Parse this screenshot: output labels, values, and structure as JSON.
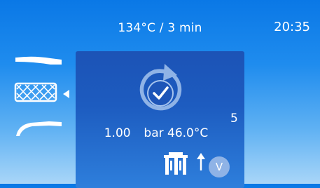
{
  "header": {
    "program": "134°C / 3 min",
    "time": "20:35"
  },
  "sidebar": {
    "items": [
      {
        "icon": "straight-handpiece-icon"
      },
      {
        "icon": "mesh-basket-icon",
        "selected": true
      },
      {
        "icon": "contra-angle-handpiece-icon"
      }
    ]
  },
  "status": {
    "icon": "cycle-complete-icon",
    "cycle_count": "5",
    "pressure_value": "1.00",
    "pressure_unit": "bar",
    "temperature": "46.0°C"
  },
  "controls": {
    "chamber_icon": "chamber-icon",
    "arrow_icon": "up-arrow-icon",
    "down_label": "V"
  },
  "colors": {
    "background_top": "#0a78e6",
    "background_bottom": "#a9d6f8",
    "panel": "#1c53b6",
    "button": "#8fb3e6",
    "foreground": "#ffffff"
  }
}
